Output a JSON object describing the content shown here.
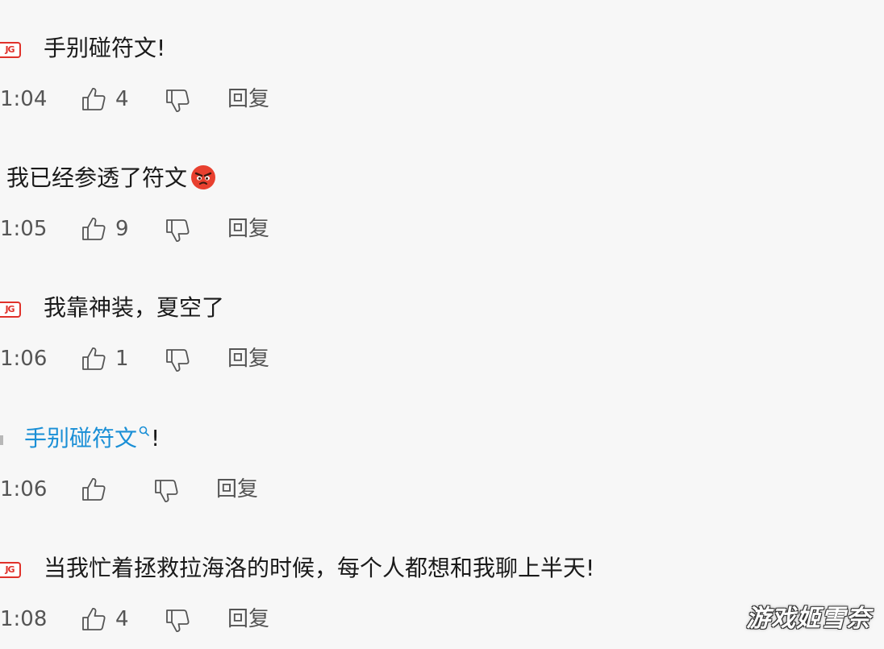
{
  "comments": [
    {
      "badge": "JG",
      "text": "手别碰符文!",
      "time": "1:04",
      "likes": "4",
      "reply": "回复"
    },
    {
      "text": "我已经参透了符文",
      "emoji": "angry-face-emoji",
      "time": "1:05",
      "likes": "9",
      "reply": "回复"
    },
    {
      "badge": "JG",
      "text": "我靠神装，夏空了",
      "time": "1:06",
      "likes": "1",
      "reply": "回复"
    },
    {
      "link_text": "手别碰符文",
      "suffix": "!",
      "time": "1:06",
      "reply": "回复"
    },
    {
      "badge": "JG",
      "text": "当我忙着拯救拉海洛的时候，每个人都想和我聊上半天!",
      "time": "1:08",
      "likes": "4",
      "reply": "回复"
    }
  ],
  "watermark": "游戏姬雪奈",
  "colors": {
    "badge": "#e0312a",
    "link": "#1a8fd6",
    "meta_text": "#555555",
    "background": "#f7f7f7"
  },
  "icons": {
    "like": "thumbs-up-icon",
    "dislike": "thumbs-down-icon",
    "search": "search-icon"
  }
}
